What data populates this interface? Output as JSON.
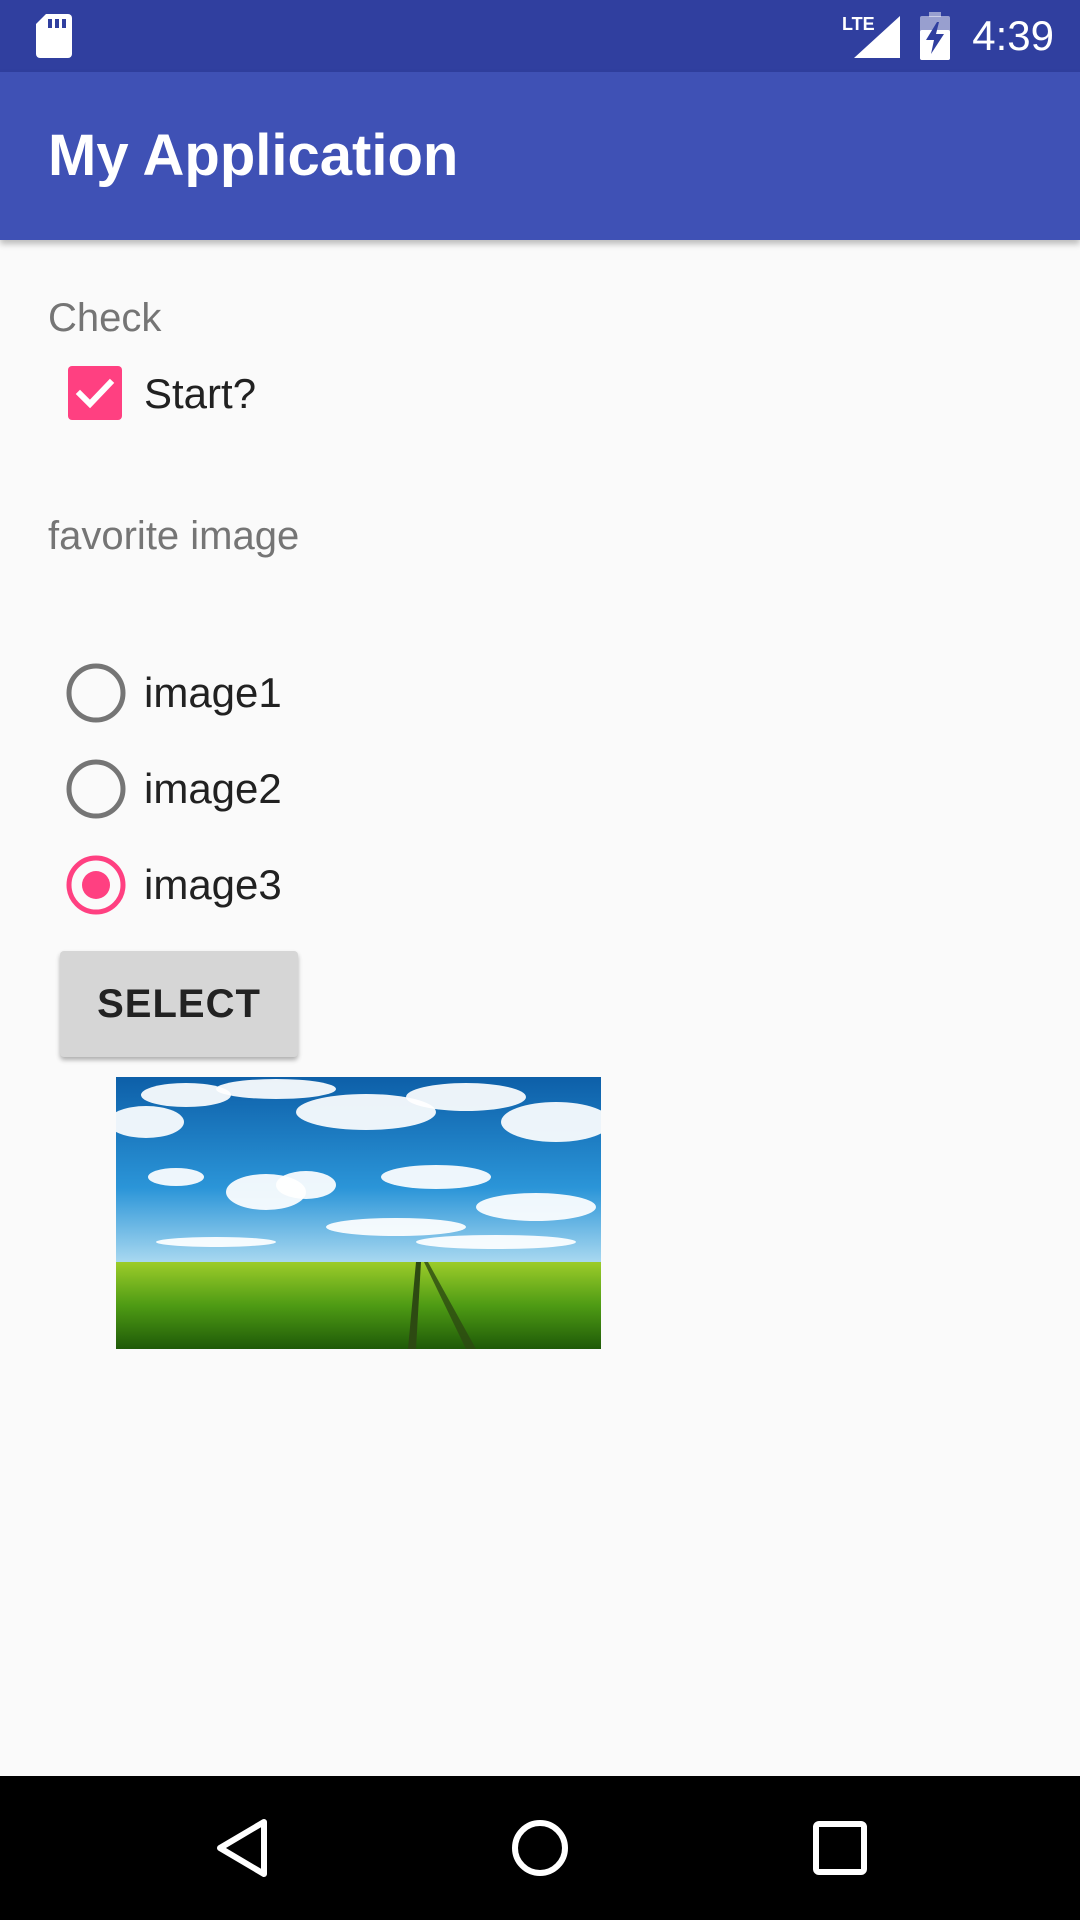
{
  "status_bar": {
    "time": "4:39",
    "network_label": "LTE",
    "icons": [
      "sd-card-icon",
      "lte-signal-icon",
      "battery-charging-icon"
    ],
    "background_color": "#303f9f"
  },
  "app_bar": {
    "title": "My Application",
    "background_color": "#3f51b5"
  },
  "form": {
    "check_section_label": "Check",
    "checkbox": {
      "label": "Start?",
      "checked": true
    },
    "favorite_section_label": "favorite image",
    "radio_options": [
      {
        "label": "image1",
        "selected": false
      },
      {
        "label": "image2",
        "selected": false
      },
      {
        "label": "image3",
        "selected": true
      }
    ],
    "select_button_label": "SELECT",
    "accent_color": "#ff4081"
  },
  "preview": {
    "image_description": "green-field-blue-sky-photo"
  },
  "nav_bar": {
    "buttons": [
      "back-icon",
      "home-icon",
      "recents-icon"
    ]
  }
}
